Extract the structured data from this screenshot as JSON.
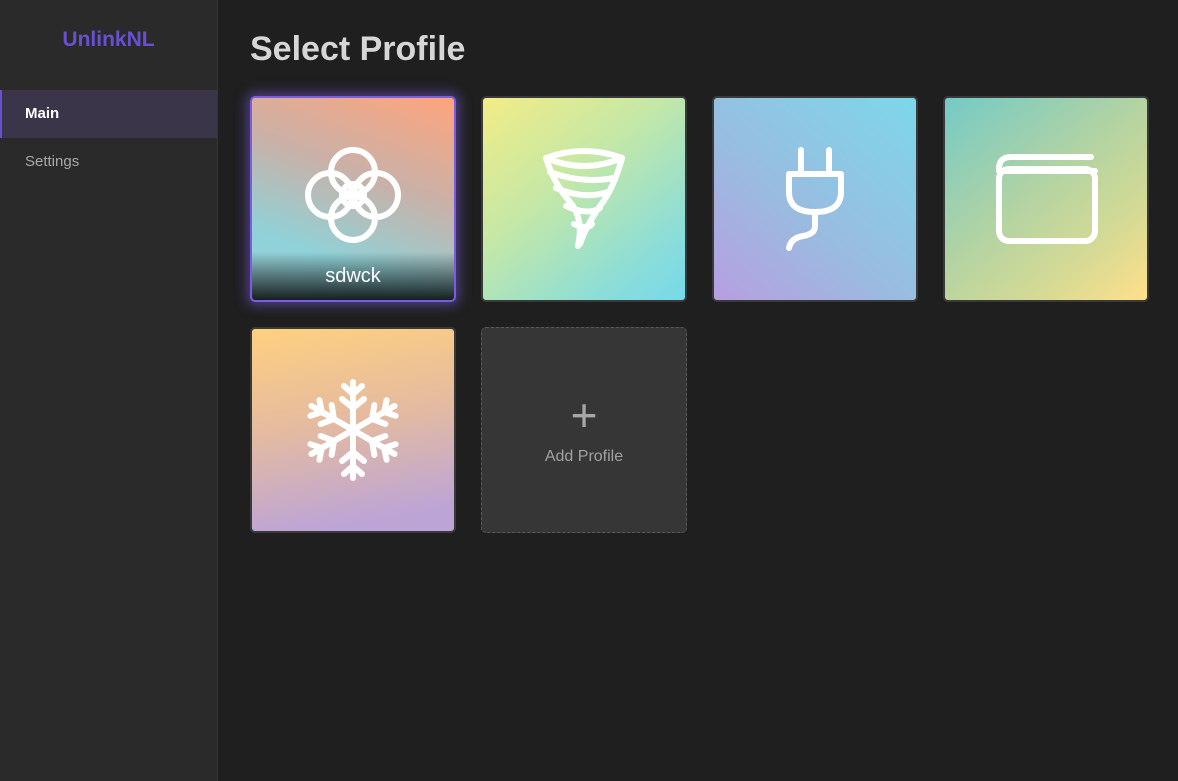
{
  "sidebar": {
    "brand": "UnlinkNL",
    "brand_color": "#6a4fd0",
    "items": [
      {
        "label": "Main",
        "active": true
      },
      {
        "label": "Settings",
        "active": false
      }
    ]
  },
  "main": {
    "title": "Select Profile",
    "profiles": [
      {
        "icon": "flower-icon",
        "name": "sdwck",
        "selected": true
      },
      {
        "icon": "tornado-icon",
        "name": "",
        "selected": false
      },
      {
        "icon": "plug-icon",
        "name": "",
        "selected": false
      },
      {
        "icon": "browser-window-icon",
        "name": "",
        "selected": false
      },
      {
        "icon": "snowflake-icon",
        "name": "",
        "selected": false
      }
    ],
    "add_profile": {
      "plus": "+",
      "label": "Add Profile"
    }
  }
}
